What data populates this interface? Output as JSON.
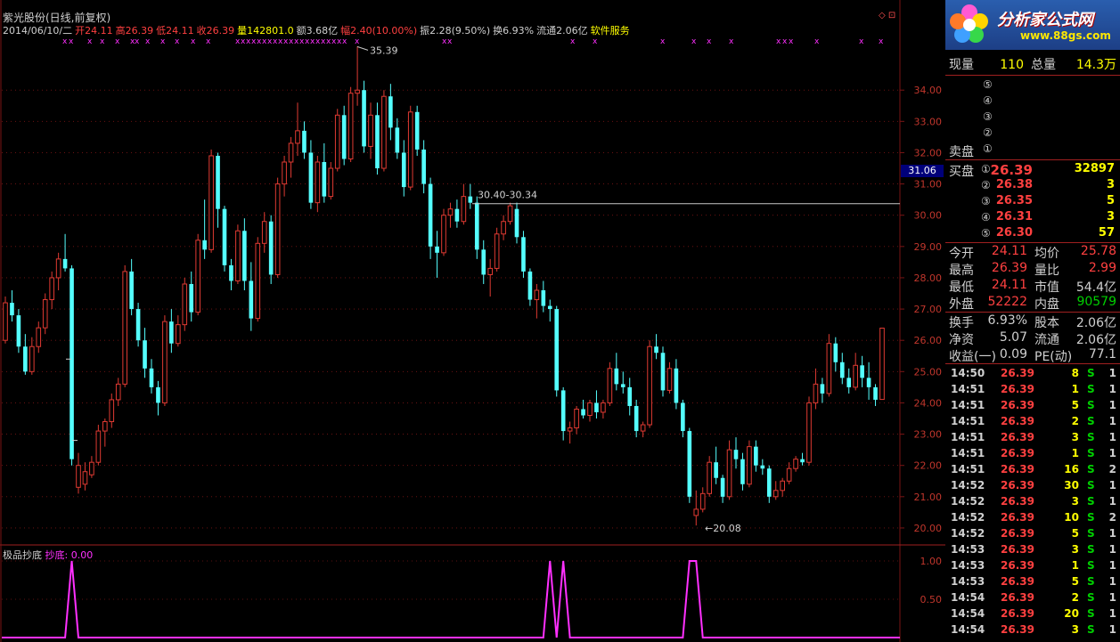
{
  "header": {
    "title": "紫光股份(日线,前复权)",
    "info": [
      {
        "text": "2014/06/10/二",
        "color": "#d0d0d0"
      },
      {
        "text": "开24.11",
        "color": "#ff4040"
      },
      {
        "text": "高26.39",
        "color": "#ff4040"
      },
      {
        "text": "低24.11",
        "color": "#ff4040"
      },
      {
        "text": "收26.39",
        "color": "#ff4040"
      },
      {
        "text": "量142801.0",
        "color": "#ffff00"
      },
      {
        "text": "额3.68亿",
        "color": "#d0d0d0"
      },
      {
        "text": "幅2.40(10.00%)",
        "color": "#ff4040"
      },
      {
        "text": "振2.28(9.50%)",
        "color": "#d0d0d0"
      },
      {
        "text": "换6.93%",
        "color": "#d0d0d0"
      },
      {
        "text": "流通2.06亿",
        "color": "#d0d0d0"
      },
      {
        "text": "软件服务",
        "color": "#ffff00"
      }
    ],
    "window_icons": "◇ ⊡"
  },
  "indicator": {
    "name": "极品抄底",
    "series_label": "抄底: 0.00"
  },
  "price_tag": "31.06",
  "annotations": {
    "high": "35.39",
    "low": "←20.08",
    "range": "30.40-30.34"
  },
  "logo": {
    "brand": "分析家公式网",
    "url": "www.88gs.com"
  },
  "panel": {
    "now": {
      "label": "现量",
      "value": "110",
      "label2": "总量",
      "value2": "14.3万"
    },
    "sell_label": "卖盘",
    "sell_circles": [
      "⑤",
      "④",
      "③",
      "②",
      "①"
    ],
    "buy_label": "买盘",
    "buy": [
      {
        "c": "①",
        "price": "26.39",
        "vol": "32897"
      },
      {
        "c": "②",
        "price": "26.38",
        "vol": "3"
      },
      {
        "c": "③",
        "price": "26.35",
        "vol": "5"
      },
      {
        "c": "④",
        "price": "26.31",
        "vol": "3"
      },
      {
        "c": "⑤",
        "price": "26.30",
        "vol": "57"
      }
    ],
    "stats": [
      {
        "l1": "今开",
        "v1": "24.11",
        "c1": "#ff4040",
        "l2": "均价",
        "v2": "25.78",
        "c2": "#ff4040"
      },
      {
        "l1": "最高",
        "v1": "26.39",
        "c1": "#ff4040",
        "l2": "量比",
        "v2": "2.99",
        "c2": "#ff4040"
      },
      {
        "l1": "最低",
        "v1": "24.11",
        "c1": "#ff4040",
        "l2": "市值",
        "v2": "54.4亿",
        "c2": "#d0d0d0"
      },
      {
        "l1": "外盘",
        "v1": "52222",
        "c1": "#ff4040",
        "l2": "内盘",
        "v2": "90579",
        "c2": "#00d000"
      }
    ],
    "stats2": [
      {
        "l1": "换手",
        "v1": "6.93%",
        "l2": "股本",
        "v2": "2.06亿"
      },
      {
        "l1": "净资",
        "v1": "5.07",
        "l2": "流通",
        "v2": "2.06亿"
      },
      {
        "l1": "收益(一)",
        "v1": "0.09",
        "l2": "PE(动)",
        "v2": "77.1"
      }
    ],
    "ticks": [
      {
        "t": "14:50",
        "p": "26.39",
        "v": "8",
        "s": "S",
        "n": "1"
      },
      {
        "t": "14:51",
        "p": "26.39",
        "v": "1",
        "s": "S",
        "n": "1"
      },
      {
        "t": "14:51",
        "p": "26.39",
        "v": "5",
        "s": "S",
        "n": "1"
      },
      {
        "t": "14:51",
        "p": "26.39",
        "v": "2",
        "s": "S",
        "n": "1"
      },
      {
        "t": "14:51",
        "p": "26.39",
        "v": "3",
        "s": "S",
        "n": "1"
      },
      {
        "t": "14:51",
        "p": "26.39",
        "v": "1",
        "s": "S",
        "n": "1"
      },
      {
        "t": "14:51",
        "p": "26.39",
        "v": "16",
        "s": "S",
        "n": "2"
      },
      {
        "t": "14:52",
        "p": "26.39",
        "v": "30",
        "s": "S",
        "n": "1"
      },
      {
        "t": "14:52",
        "p": "26.39",
        "v": "3",
        "s": "S",
        "n": "1"
      },
      {
        "t": "14:52",
        "p": "26.39",
        "v": "10",
        "s": "S",
        "n": "2"
      },
      {
        "t": "14:52",
        "p": "26.39",
        "v": "5",
        "s": "S",
        "n": "1"
      },
      {
        "t": "14:53",
        "p": "26.39",
        "v": "3",
        "s": "S",
        "n": "1"
      },
      {
        "t": "14:53",
        "p": "26.39",
        "v": "1",
        "s": "S",
        "n": "1"
      },
      {
        "t": "14:53",
        "p": "26.39",
        "v": "5",
        "s": "S",
        "n": "1"
      },
      {
        "t": "14:54",
        "p": "26.39",
        "v": "2",
        "s": "S",
        "n": "1"
      },
      {
        "t": "14:54",
        "p": "26.39",
        "v": "20",
        "s": "S",
        "n": "1"
      },
      {
        "t": "14:54",
        "p": "26.39",
        "v": "3",
        "s": "S",
        "n": "1"
      }
    ]
  },
  "chart_data": {
    "type": "candlestick",
    "title": "紫光股份(日线,前复权)",
    "ylim": [
      19.6,
      35.6
    ],
    "y_ticks": [
      "20.00",
      "21.00",
      "22.00",
      "23.00",
      "24.00",
      "25.00",
      "26.00",
      "27.00",
      "28.00",
      "29.00",
      "30.00",
      "31.00",
      "32.00",
      "33.00",
      "34.00"
    ],
    "indicator_ticks": [
      "1.00",
      "0.50"
    ],
    "candles": [
      [
        26.0,
        27.4,
        25.9,
        27.2
      ],
      [
        27.2,
        27.6,
        26.6,
        26.8
      ],
      [
        26.8,
        27.0,
        25.6,
        25.8
      ],
      [
        25.8,
        26.2,
        24.9,
        25.0
      ],
      [
        25.0,
        26.1,
        24.9,
        25.8
      ],
      [
        25.8,
        26.6,
        25.6,
        26.4
      ],
      [
        26.4,
        27.5,
        26.2,
        27.3
      ],
      [
        27.3,
        28.2,
        27.0,
        28.0
      ],
      [
        28.0,
        28.8,
        27.6,
        28.6
      ],
      [
        28.6,
        29.4,
        28.2,
        28.3
      ],
      [
        28.3,
        28.4,
        22.0,
        22.2
      ],
      [
        21.3,
        22.4,
        21.1,
        22.0
      ],
      [
        21.4,
        22.1,
        21.2,
        21.8
      ],
      [
        21.7,
        22.3,
        21.6,
        22.1
      ],
      [
        22.1,
        23.3,
        22.0,
        23.1
      ],
      [
        23.1,
        23.5,
        22.6,
        23.4
      ],
      [
        23.4,
        24.3,
        23.2,
        24.1
      ],
      [
        24.1,
        24.8,
        23.9,
        24.6
      ],
      [
        24.6,
        28.4,
        24.5,
        28.2
      ],
      [
        28.2,
        28.6,
        26.8,
        27.0
      ],
      [
        27.0,
        27.2,
        25.8,
        26.0
      ],
      [
        26.0,
        26.4,
        24.8,
        25.1
      ],
      [
        25.1,
        25.4,
        24.3,
        24.5
      ],
      [
        24.5,
        24.7,
        23.6,
        24.0
      ],
      [
        24.0,
        26.8,
        23.9,
        26.6
      ],
      [
        26.6,
        27.0,
        25.6,
        25.9
      ],
      [
        25.9,
        26.8,
        25.8,
        26.5
      ],
      [
        26.5,
        28.0,
        26.3,
        27.8
      ],
      [
        27.8,
        28.2,
        26.6,
        26.9
      ],
      [
        26.9,
        29.4,
        26.8,
        29.2
      ],
      [
        29.2,
        30.5,
        28.6,
        28.9
      ],
      [
        28.9,
        32.1,
        28.8,
        31.9
      ],
      [
        31.9,
        32.0,
        29.6,
        30.2
      ],
      [
        30.2,
        30.3,
        28.2,
        28.4
      ],
      [
        28.4,
        28.6,
        27.6,
        27.9
      ],
      [
        27.9,
        29.7,
        27.8,
        29.5
      ],
      [
        29.5,
        29.9,
        27.6,
        27.9
      ],
      [
        27.9,
        28.5,
        26.3,
        26.7
      ],
      [
        26.7,
        29.3,
        26.6,
        29.1
      ],
      [
        29.1,
        30.1,
        28.8,
        29.8
      ],
      [
        29.8,
        30.0,
        27.8,
        28.1
      ],
      [
        28.1,
        31.2,
        28.0,
        31.0
      ],
      [
        31.0,
        31.9,
        30.6,
        31.7
      ],
      [
        31.7,
        32.5,
        31.2,
        32.3
      ],
      [
        32.3,
        33.6,
        31.9,
        32.7
      ],
      [
        32.7,
        33.0,
        31.8,
        32.0
      ],
      [
        32.0,
        32.4,
        30.2,
        30.4
      ],
      [
        30.4,
        31.9,
        30.1,
        31.7
      ],
      [
        31.7,
        32.3,
        30.4,
        30.6
      ],
      [
        30.6,
        31.7,
        30.5,
        31.5
      ],
      [
        31.5,
        33.4,
        31.4,
        33.2
      ],
      [
        33.2,
        33.5,
        31.6,
        31.8
      ],
      [
        31.8,
        34.1,
        31.7,
        33.9
      ],
      [
        33.9,
        35.4,
        33.5,
        34.0
      ],
      [
        34.0,
        34.3,
        32.0,
        32.2
      ],
      [
        32.2,
        33.6,
        31.8,
        33.2
      ],
      [
        33.2,
        33.6,
        31.3,
        31.5
      ],
      [
        31.5,
        34.0,
        31.4,
        33.8
      ],
      [
        33.8,
        34.2,
        32.4,
        32.8
      ],
      [
        32.8,
        33.1,
        31.8,
        32.0
      ],
      [
        32.0,
        32.4,
        30.6,
        30.9
      ],
      [
        30.9,
        33.5,
        30.8,
        33.3
      ],
      [
        33.3,
        33.5,
        31.9,
        32.1
      ],
      [
        32.1,
        32.4,
        30.7,
        31.0
      ],
      [
        31.0,
        31.2,
        28.6,
        29.0
      ],
      [
        29.0,
        29.5,
        28.0,
        28.8
      ],
      [
        28.8,
        30.2,
        28.7,
        30.0
      ],
      [
        30.0,
        30.4,
        29.6,
        30.2
      ],
      [
        30.2,
        30.5,
        29.6,
        29.8
      ],
      [
        29.8,
        31.0,
        29.7,
        30.6
      ],
      [
        30.6,
        31.0,
        30.2,
        30.4
      ],
      [
        30.4,
        30.6,
        28.6,
        28.9
      ],
      [
        28.9,
        29.2,
        27.8,
        28.1
      ],
      [
        28.1,
        28.6,
        27.4,
        28.3
      ],
      [
        28.3,
        29.6,
        28.2,
        29.4
      ],
      [
        29.4,
        30.0,
        29.2,
        29.8
      ],
      [
        29.8,
        30.4,
        29.7,
        30.3
      ],
      [
        30.2,
        30.4,
        29.1,
        29.3
      ],
      [
        29.3,
        29.5,
        28.0,
        28.2
      ],
      [
        28.2,
        28.3,
        27.1,
        27.3
      ],
      [
        27.3,
        27.8,
        26.7,
        27.6
      ],
      [
        27.6,
        27.9,
        26.9,
        27.1
      ],
      [
        27.1,
        27.3,
        26.6,
        27.0
      ],
      [
        27.0,
        27.1,
        24.2,
        24.4
      ],
      [
        24.4,
        24.5,
        22.8,
        23.1
      ],
      [
        23.1,
        23.4,
        22.7,
        23.2
      ],
      [
        23.2,
        23.9,
        23.0,
        23.8
      ],
      [
        23.8,
        24.1,
        23.5,
        23.6
      ],
      [
        23.6,
        24.1,
        23.4,
        24.0
      ],
      [
        24.0,
        24.4,
        23.5,
        23.7
      ],
      [
        23.7,
        24.1,
        23.5,
        24.0
      ],
      [
        24.0,
        25.3,
        23.9,
        25.1
      ],
      [
        25.1,
        25.6,
        24.4,
        24.6
      ],
      [
        24.6,
        25.0,
        24.3,
        24.5
      ],
      [
        24.5,
        24.8,
        23.6,
        23.9
      ],
      [
        23.9,
        24.1,
        22.9,
        23.1
      ],
      [
        23.1,
        23.4,
        22.9,
        23.3
      ],
      [
        23.3,
        26.0,
        23.2,
        25.8
      ],
      [
        25.8,
        26.2,
        25.4,
        25.6
      ],
      [
        25.6,
        25.8,
        24.2,
        24.4
      ],
      [
        24.4,
        25.3,
        24.3,
        25.1
      ],
      [
        25.1,
        25.4,
        23.8,
        24.0
      ],
      [
        24.0,
        24.1,
        22.9,
        23.1
      ],
      [
        23.1,
        23.2,
        20.8,
        21.0
      ],
      [
        20.4,
        21.2,
        20.08,
        20.6
      ],
      [
        20.6,
        21.3,
        20.5,
        21.1
      ],
      [
        21.1,
        22.3,
        21.0,
        22.1
      ],
      [
        22.1,
        22.6,
        21.4,
        21.6
      ],
      [
        21.6,
        21.7,
        20.8,
        21.0
      ],
      [
        21.0,
        22.8,
        20.9,
        22.5
      ],
      [
        22.5,
        22.9,
        21.9,
        22.2
      ],
      [
        22.2,
        22.4,
        21.2,
        21.4
      ],
      [
        21.4,
        22.8,
        21.3,
        22.6
      ],
      [
        22.6,
        22.8,
        21.8,
        22.0
      ],
      [
        22.0,
        22.2,
        21.7,
        21.9
      ],
      [
        21.9,
        22.0,
        20.8,
        21.0
      ],
      [
        21.0,
        21.5,
        20.9,
        21.2
      ],
      [
        21.2,
        21.6,
        21.0,
        21.5
      ],
      [
        21.5,
        22.1,
        21.4,
        21.9
      ],
      [
        21.9,
        22.3,
        21.8,
        22.2
      ],
      [
        22.2,
        22.4,
        22.0,
        22.1
      ],
      [
        22.1,
        24.2,
        22.0,
        24.0
      ],
      [
        24.0,
        25.1,
        23.8,
        24.6
      ],
      [
        24.6,
        24.8,
        24.0,
        24.3
      ],
      [
        24.3,
        26.2,
        24.2,
        25.9
      ],
      [
        25.9,
        26.1,
        25.0,
        25.3
      ],
      [
        25.3,
        25.6,
        24.6,
        24.8
      ],
      [
        24.8,
        25.1,
        24.3,
        24.5
      ],
      [
        24.5,
        25.6,
        24.4,
        25.2
      ],
      [
        25.2,
        25.5,
        24.5,
        24.8
      ],
      [
        24.8,
        25.3,
        24.1,
        24.5
      ],
      [
        24.5,
        24.6,
        23.9,
        24.1
      ],
      [
        24.11,
        26.39,
        24.11,
        26.39
      ]
    ],
    "signals": [
      {
        "index": 10,
        "value": 1
      },
      {
        "index": 82,
        "value": 1
      },
      {
        "index": 84,
        "value": 1
      },
      {
        "index": 103,
        "value": 1
      },
      {
        "index": 104,
        "value": 1
      }
    ]
  },
  "colors": {
    "up": "#e03a32",
    "down": "#54ffff",
    "grid": "#7a1515",
    "signal": "#ff30ff"
  }
}
